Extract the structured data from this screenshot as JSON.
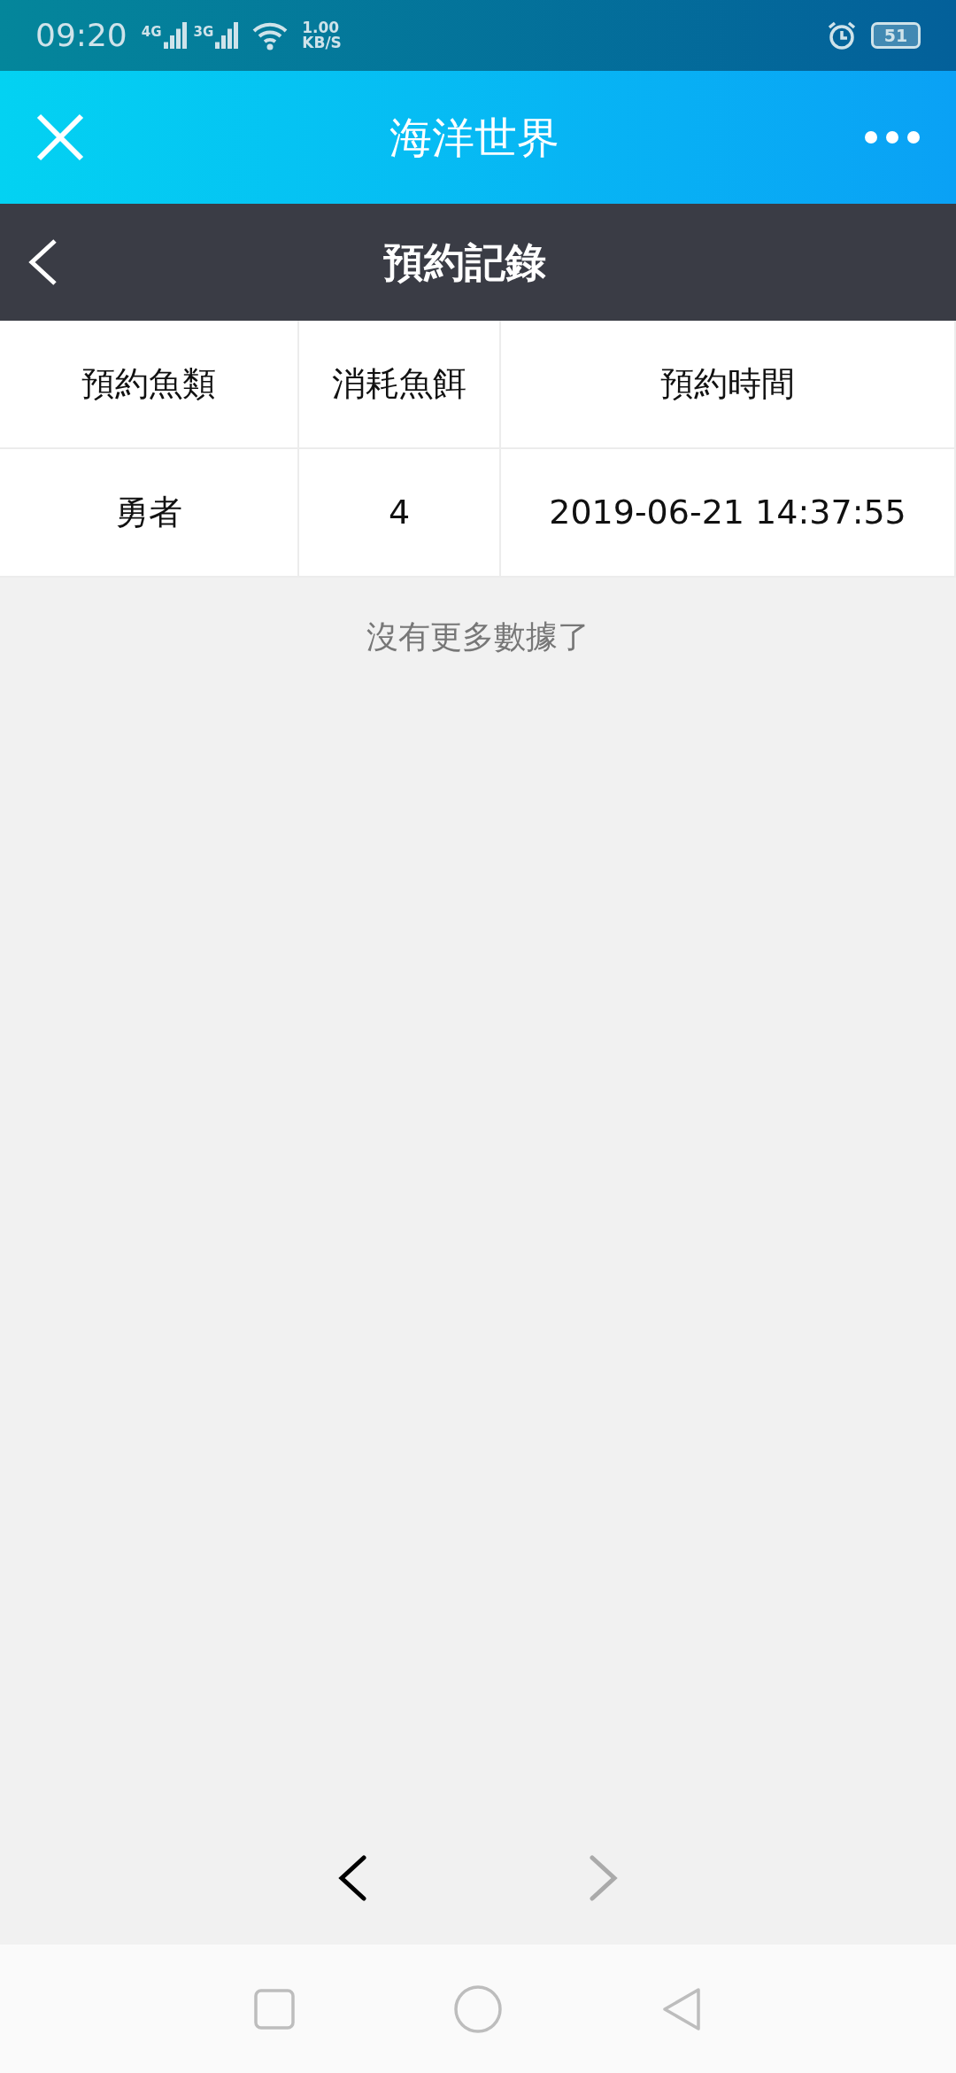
{
  "status_bar": {
    "time": "09:20",
    "signals": [
      "4G",
      "3G"
    ],
    "speed_value": "1.00",
    "speed_unit": "KB/S",
    "battery": "51"
  },
  "app_bar": {
    "title": "海洋世界"
  },
  "page_header": {
    "title": "預約記錄"
  },
  "table": {
    "columns": [
      "預約魚類",
      "消耗魚餌",
      "預約時間"
    ],
    "rows": [
      [
        "勇者",
        "4",
        "2019-06-21 14:37:55"
      ]
    ]
  },
  "end_message": "沒有更多數據了",
  "browser_toolbar": {
    "back_disabled": false,
    "forward_disabled": true
  }
}
